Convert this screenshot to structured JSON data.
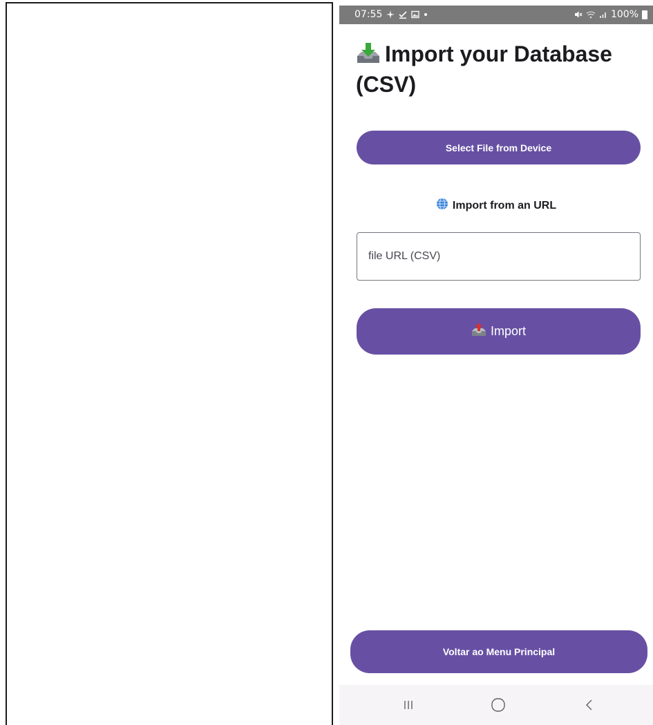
{
  "status_bar": {
    "time": "07:55",
    "battery_text": "100%",
    "icons": [
      "fan-icon",
      "check-download-icon",
      "gallery-icon",
      "dot-icon",
      "mute-icon",
      "wifi-icon",
      "signal-icon",
      "battery-icon"
    ]
  },
  "page": {
    "title": "Import your Database (CSV)",
    "title_icon": "inbox-download-icon"
  },
  "select_file_button": {
    "label": "Select File from Device"
  },
  "url_section": {
    "heading": "Import from an URL",
    "heading_icon": "globe-icon",
    "input_value": "",
    "input_placeholder": "file URL (CSV)"
  },
  "import_button": {
    "label": "Import",
    "icon": "outbox-upload-icon"
  },
  "back_button": {
    "label": "Voltar ao Menu Principal"
  },
  "nav_bar": {
    "items": [
      "recents-icon",
      "home-icon",
      "back-icon"
    ]
  },
  "colors": {
    "primary": "#6750a4",
    "status_bar": "#7a7a7a",
    "nav_bar": "#f7f4f8",
    "text": "#1c1b1f"
  }
}
